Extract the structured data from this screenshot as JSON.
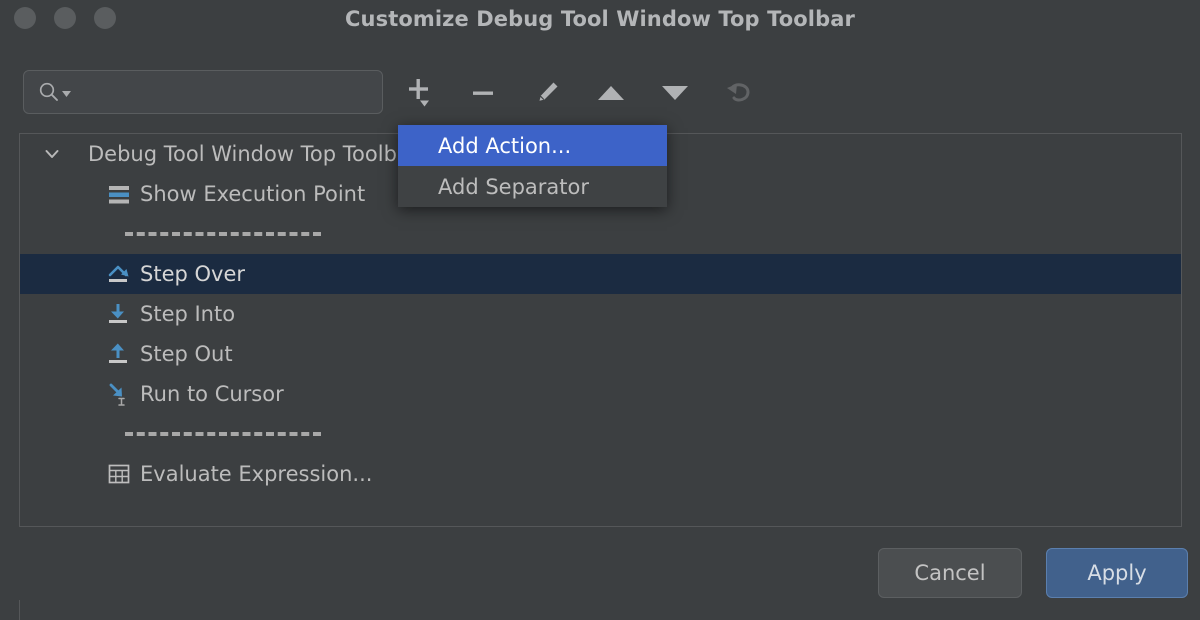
{
  "window": {
    "title": "Customize Debug Tool Window Top Toolbar",
    "traffic_lights": [
      "close",
      "minimize",
      "maximize"
    ]
  },
  "toolbar": {
    "search": {
      "value": "",
      "placeholder": "",
      "icon": "search-icon",
      "dropdown_icon": "chevron-down-icon"
    },
    "buttons": [
      {
        "name": "add-button",
        "icon": "plus-icon",
        "label": "Add",
        "enabled": true,
        "has_dropdown": true
      },
      {
        "name": "remove-button",
        "icon": "minus-icon",
        "label": "Remove",
        "enabled": true,
        "has_dropdown": false
      },
      {
        "name": "edit-button",
        "icon": "pencil-icon",
        "label": "Edit",
        "enabled": true,
        "has_dropdown": false
      },
      {
        "name": "move-up-button",
        "icon": "arrow-up-icon",
        "label": "Move Up",
        "enabled": true,
        "has_dropdown": false
      },
      {
        "name": "move-down-button",
        "icon": "arrow-down-icon",
        "label": "Move Down",
        "enabled": true,
        "has_dropdown": false
      },
      {
        "name": "restore-button",
        "icon": "undo-icon",
        "label": "Restore Default",
        "enabled": false,
        "has_dropdown": false
      }
    ]
  },
  "menu": {
    "items": [
      {
        "label": "Add Action...",
        "highlighted": true
      },
      {
        "label": "Add Separator",
        "highlighted": false
      }
    ]
  },
  "tree": {
    "root": {
      "label": "Debug Tool Window Top Toolbar",
      "expanded": true,
      "chevron_icon": "chevron-down-icon"
    },
    "rows": [
      {
        "type": "action",
        "label": "Show Execution Point",
        "icon": "show-execution-point-icon",
        "selected": false
      },
      {
        "type": "separator",
        "label": "",
        "icon": "separator-icon",
        "selected": false
      },
      {
        "type": "action",
        "label": "Step Over",
        "icon": "step-over-icon",
        "selected": true
      },
      {
        "type": "action",
        "label": "Step Into",
        "icon": "step-into-icon",
        "selected": false
      },
      {
        "type": "action",
        "label": "Step Out",
        "icon": "step-out-icon",
        "selected": false
      },
      {
        "type": "action",
        "label": "Run to Cursor",
        "icon": "run-to-cursor-icon",
        "selected": false
      },
      {
        "type": "separator",
        "label": "",
        "icon": "separator-icon",
        "selected": false
      },
      {
        "type": "action",
        "label": "Evaluate Expression...",
        "icon": "evaluate-expression-icon",
        "selected": false
      }
    ]
  },
  "footer": {
    "cancel_label": "Cancel",
    "apply_label": "Apply"
  },
  "colors": {
    "window_background": "#3c3f41",
    "panel_border": "#555759",
    "selection_row": "#1b2b41",
    "menu_highlight": "#3d63c8",
    "apply_button": "#41618c",
    "icon_blue": "#4a90c4",
    "text": "#bbbbbb"
  }
}
